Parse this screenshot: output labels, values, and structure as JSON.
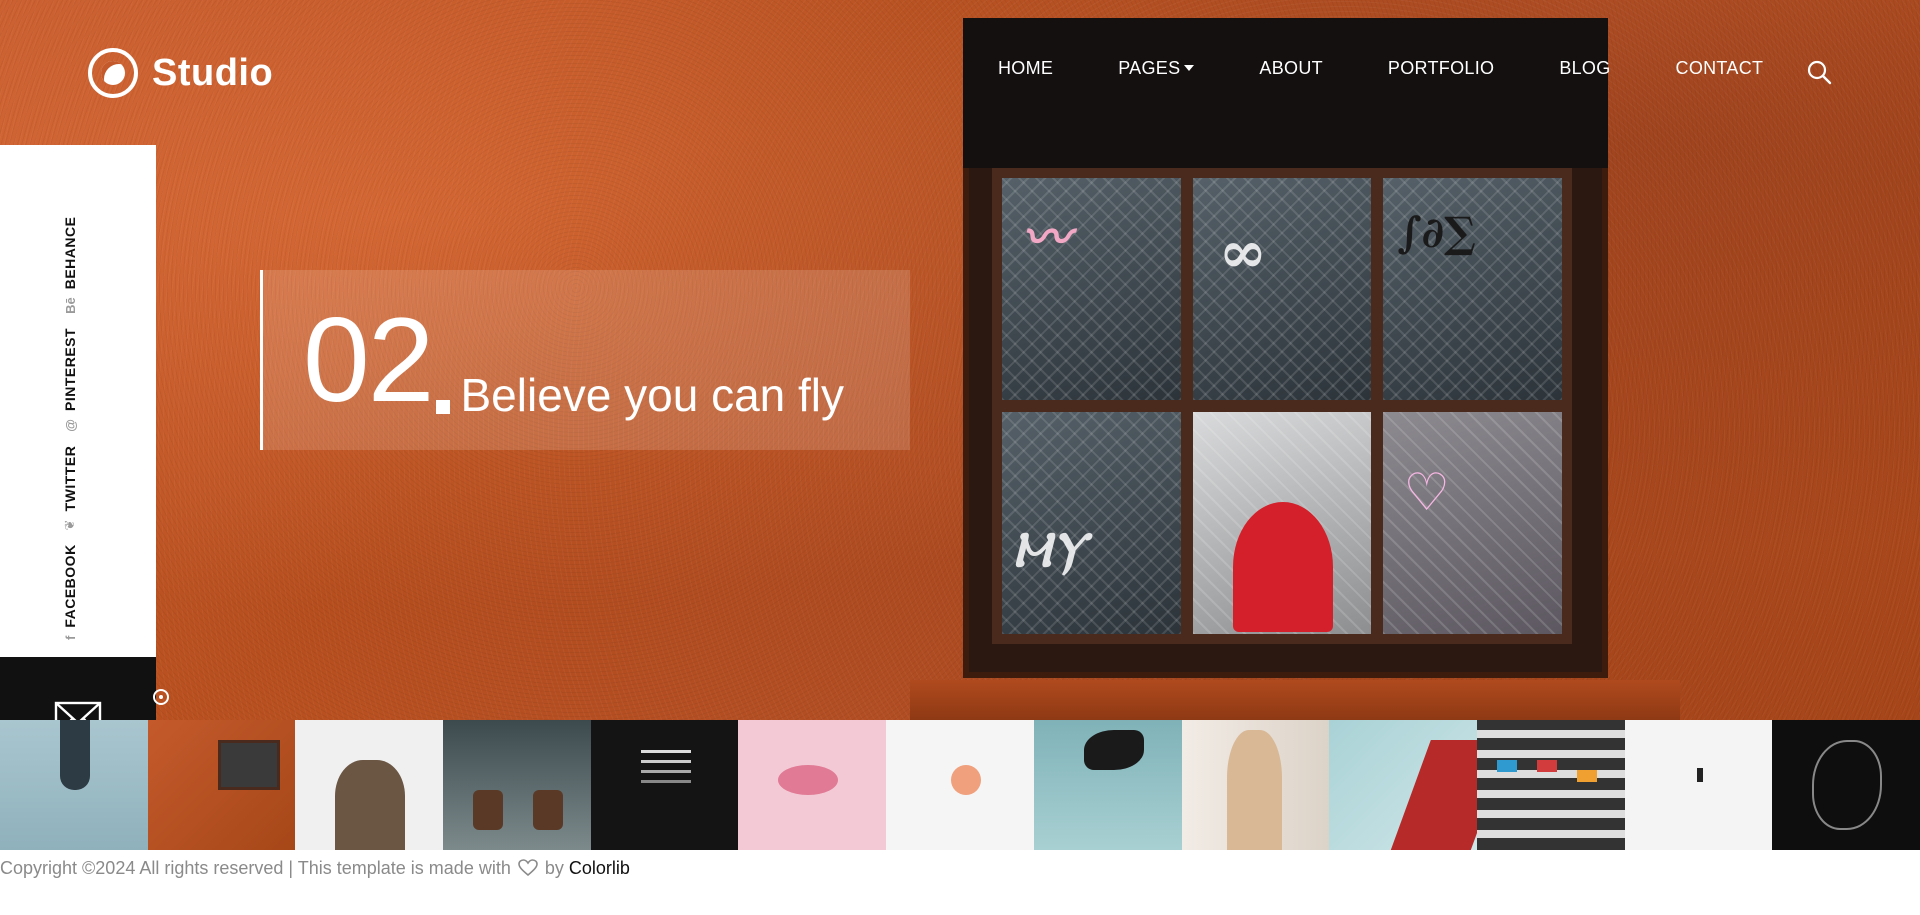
{
  "brand": {
    "name": "Studio"
  },
  "nav": {
    "items": [
      {
        "label": "HOME",
        "dropdown": false
      },
      {
        "label": "PAGES",
        "dropdown": true
      },
      {
        "label": "ABOUT",
        "dropdown": false
      },
      {
        "label": "PORTFOLIO",
        "dropdown": false
      },
      {
        "label": "BLOG",
        "dropdown": false
      },
      {
        "label": "CONTACT",
        "dropdown": false
      }
    ],
    "search_icon": "search-icon"
  },
  "social": {
    "items": [
      {
        "label": "FACEBOOK",
        "icon": "f"
      },
      {
        "label": "TWITTER",
        "icon": "❦"
      },
      {
        "label": "PINTEREST",
        "icon": "@"
      },
      {
        "label": "BEHANCE",
        "icon": "Bē"
      }
    ]
  },
  "slide": {
    "number": "02",
    "caption": "Believe you can fly"
  },
  "thumbnails": {
    "count": 13
  },
  "footer": {
    "text_before": "Copyright ©2024 All rights reserved | This template is made with",
    "text_by": "by",
    "link_label": "Colorlib"
  },
  "colors": {
    "hero_orange": "#c45a2c",
    "dark": "#111111",
    "footer_text": "#8a8a8a"
  }
}
